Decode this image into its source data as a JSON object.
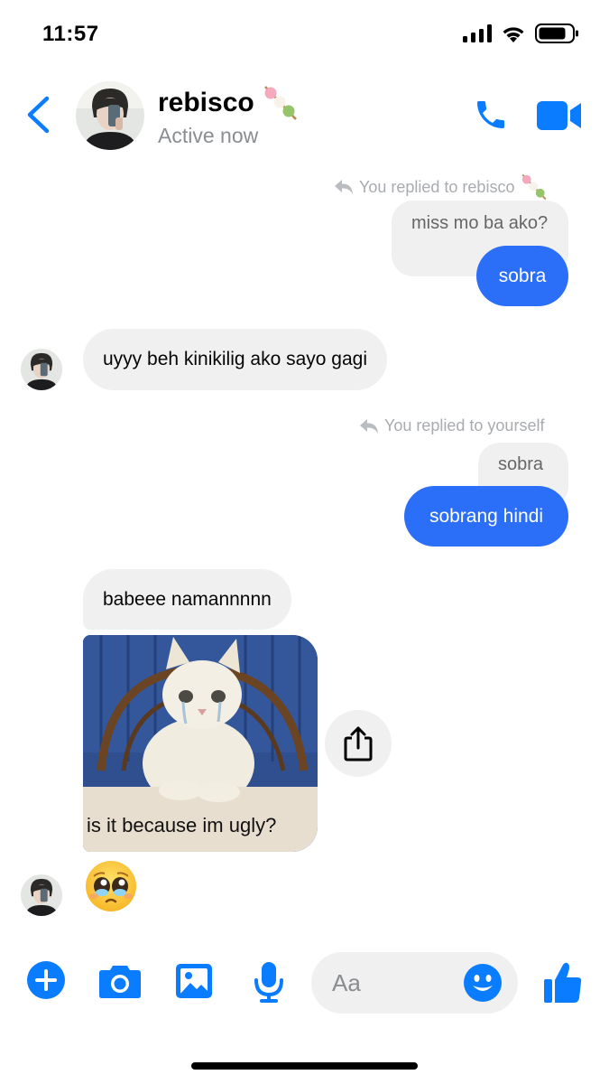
{
  "status_bar": {
    "time": "11:57"
  },
  "header": {
    "contact_name": "rebisco",
    "contact_status": "Active now"
  },
  "messages": {
    "reply1": {
      "note": "You replied to rebisco",
      "quoted": "miss mo ba ako?",
      "text": "sobra"
    },
    "them1": {
      "text": "uyyy beh kinikilig ako sayo gagi"
    },
    "reply2": {
      "note": "You replied to yourself",
      "quoted": "sobra",
      "text": "sobrang hindi"
    },
    "them2": {
      "text": "babeee namannnnn"
    },
    "meme": {
      "caption": "is it because im ugly?"
    },
    "emoji": {
      "name": "pleading-face"
    }
  },
  "composer": {
    "placeholder": "Aa"
  },
  "colors": {
    "accent": "#0a7cff",
    "my_bubble": "#2b6ef8",
    "their_bubble": "#f0f0f0",
    "muted_text": "#8a8d91"
  },
  "icons": [
    "chevron-left-icon",
    "phone-icon",
    "video-camera-icon",
    "reply-arrow-icon",
    "share-icon",
    "plus-icon",
    "camera-icon",
    "gallery-icon",
    "microphone-icon",
    "smiley-icon",
    "thumbs-up-icon",
    "dango-icon",
    "signal-icon",
    "wifi-icon",
    "battery-icon"
  ]
}
